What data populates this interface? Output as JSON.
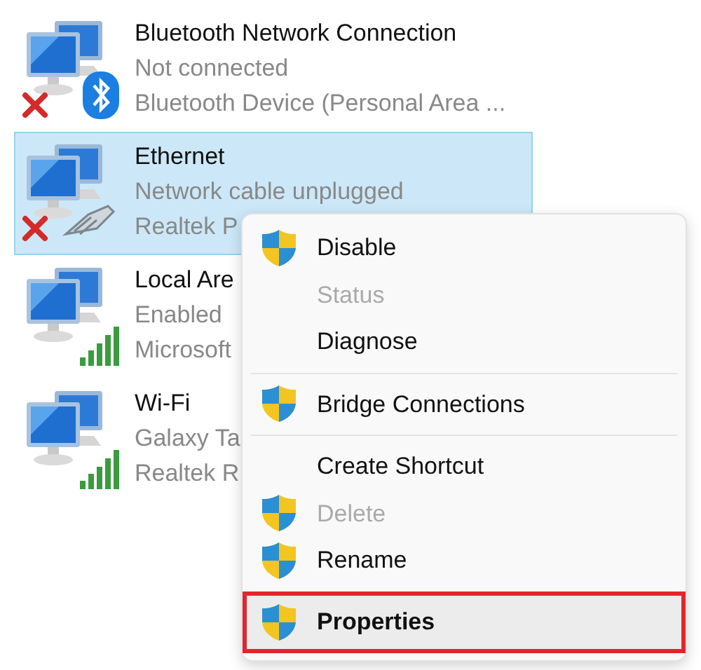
{
  "connections": [
    {
      "name": "Bluetooth Network Connection",
      "status": "Not connected",
      "device": "Bluetooth Device (Personal Area ...",
      "kind": "bluetooth",
      "disconnected": true,
      "selected": false
    },
    {
      "name": "Ethernet",
      "status": "Network cable unplugged",
      "device": "Realtek P",
      "kind": "cable",
      "disconnected": true,
      "selected": true
    },
    {
      "name": "Local Are",
      "status": "Enabled",
      "device": "Microsoft",
      "kind": "signal",
      "disconnected": false,
      "selected": false
    },
    {
      "name": "Wi-Fi",
      "status": "Galaxy Ta",
      "device": "Realtek R",
      "kind": "signal",
      "disconnected": false,
      "selected": false
    }
  ],
  "context_menu": [
    {
      "kind": "item",
      "label": "Disable",
      "shield": true,
      "disabled": false,
      "default": false,
      "selected": false
    },
    {
      "kind": "item",
      "label": "Status",
      "shield": false,
      "disabled": true,
      "default": false,
      "selected": false
    },
    {
      "kind": "item",
      "label": "Diagnose",
      "shield": false,
      "disabled": false,
      "default": false,
      "selected": false
    },
    {
      "kind": "separator"
    },
    {
      "kind": "item",
      "label": "Bridge Connections",
      "shield": true,
      "disabled": false,
      "default": false,
      "selected": false
    },
    {
      "kind": "separator"
    },
    {
      "kind": "item",
      "label": "Create Shortcut",
      "shield": false,
      "disabled": false,
      "default": false,
      "selected": false
    },
    {
      "kind": "item",
      "label": "Delete",
      "shield": true,
      "disabled": true,
      "default": false,
      "selected": false
    },
    {
      "kind": "item",
      "label": "Rename",
      "shield": true,
      "disabled": false,
      "default": false,
      "selected": false
    },
    {
      "kind": "item",
      "label": "Properties",
      "shield": true,
      "disabled": false,
      "default": true,
      "selected": true,
      "outlined": true
    }
  ]
}
